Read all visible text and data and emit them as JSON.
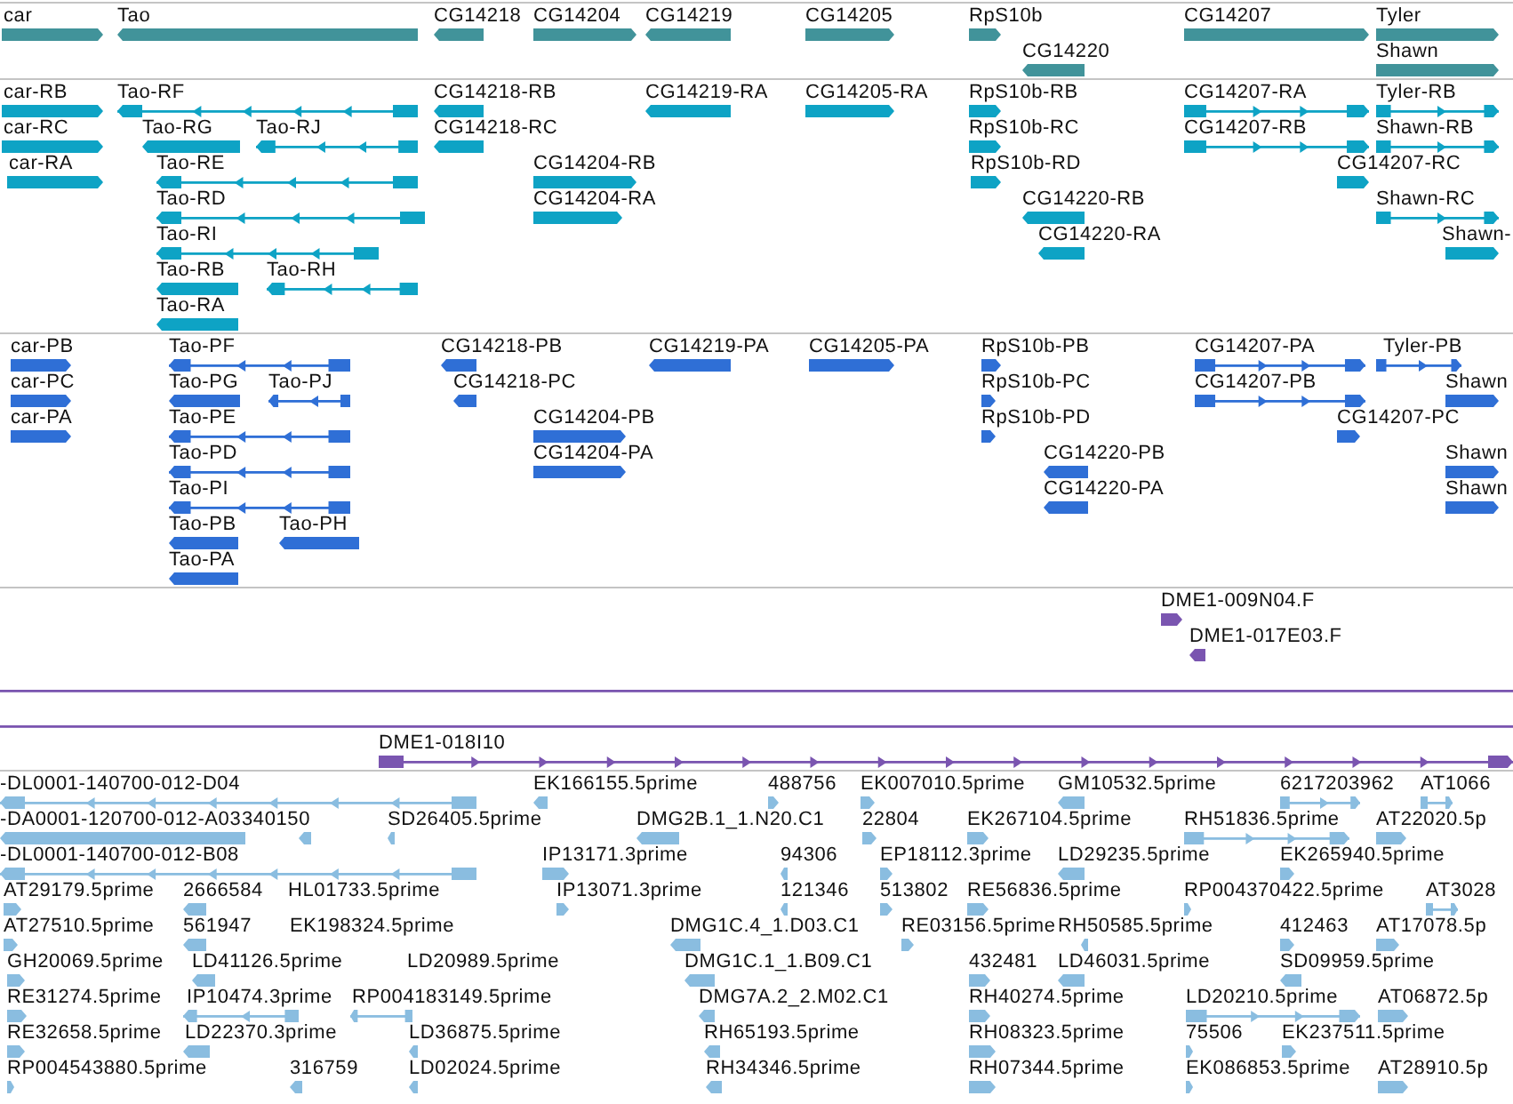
{
  "tracks": [
    {
      "color": "#41939a",
      "lanes": [
        {
          "features": [
            {
              "label": "car",
              "reverse": false,
              "kind": "block"
            },
            {
              "label": "Tao",
              "reverse": true,
              "kind": "block"
            },
            {
              "label": "CG14218",
              "reverse": true,
              "kind": "block"
            },
            {
              "label": "CG14204",
              "reverse": false,
              "kind": "block"
            },
            {
              "label": "CG14219",
              "reverse": true,
              "kind": "block"
            },
            {
              "label": "CG14205",
              "reverse": false,
              "kind": "block"
            },
            {
              "label": "RpS10b",
              "reverse": false,
              "kind": "block"
            },
            {
              "label": "CG14207",
              "reverse": false,
              "kind": "block"
            },
            {
              "label": "Tyler",
              "reverse": false,
              "kind": "block"
            }
          ]
        },
        {
          "features": [
            {
              "label": "CG14220",
              "reverse": true,
              "kind": "block"
            },
            {
              "label": "Shawn",
              "reverse": false,
              "kind": "block"
            }
          ]
        }
      ]
    },
    {
      "color": "#0ea3c5",
      "lanes": [
        {
          "features": [
            {
              "label": "car-RB",
              "reverse": false,
              "kind": "block"
            },
            {
              "label": "Tao-RF",
              "reverse": true,
              "kind": "spliced"
            },
            {
              "label": "CG14218-RB",
              "reverse": true,
              "kind": "block"
            },
            {
              "label": "CG14219-RA",
              "reverse": true,
              "kind": "block"
            },
            {
              "label": "CG14205-RA",
              "reverse": false,
              "kind": "block"
            },
            {
              "label": "RpS10b-RB",
              "reverse": false,
              "kind": "block"
            },
            {
              "label": "CG14207-RA",
              "reverse": false,
              "kind": "spliced"
            },
            {
              "label": "Tyler-RB",
              "reverse": false,
              "kind": "spliced"
            }
          ]
        },
        {
          "features": [
            {
              "label": "car-RC",
              "reverse": false,
              "kind": "block"
            },
            {
              "label": "Tao-RG",
              "reverse": true,
              "kind": "block"
            },
            {
              "label": "Tao-RJ",
              "reverse": true,
              "kind": "spliced"
            },
            {
              "label": "CG14218-RC",
              "reverse": true,
              "kind": "block"
            },
            {
              "label": "RpS10b-RC",
              "reverse": false,
              "kind": "block"
            },
            {
              "label": "CG14207-RB",
              "reverse": false,
              "kind": "spliced"
            },
            {
              "label": "Shawn-RB",
              "reverse": false,
              "kind": "spliced"
            }
          ]
        },
        {
          "features": [
            {
              "label": "car-RA",
              "reverse": false,
              "kind": "block"
            },
            {
              "label": "Tao-RE",
              "reverse": true,
              "kind": "spliced"
            },
            {
              "label": "CG14204-RB",
              "reverse": false,
              "kind": "block"
            },
            {
              "label": "RpS10b-RD",
              "reverse": false,
              "kind": "block"
            },
            {
              "label": "CG14207-RC",
              "reverse": false,
              "kind": "block"
            }
          ]
        },
        {
          "features": [
            {
              "label": "Tao-RD",
              "reverse": true,
              "kind": "spliced"
            },
            {
              "label": "CG14204-RA",
              "reverse": false,
              "kind": "block"
            },
            {
              "label": "CG14220-RB",
              "reverse": true,
              "kind": "block"
            },
            {
              "label": "Shawn-RC",
              "reverse": false,
              "kind": "spliced"
            }
          ]
        },
        {
          "features": [
            {
              "label": "Tao-RI",
              "reverse": true,
              "kind": "spliced"
            },
            {
              "label": "CG14220-RA",
              "reverse": true,
              "kind": "block"
            },
            {
              "label": "Shawn-",
              "reverse": false,
              "kind": "block"
            }
          ]
        },
        {
          "features": [
            {
              "label": "Tao-RB",
              "reverse": true,
              "kind": "block"
            },
            {
              "label": "Tao-RH",
              "reverse": true,
              "kind": "spliced"
            }
          ]
        },
        {
          "features": [
            {
              "label": "Tao-RA",
              "reverse": true,
              "kind": "block"
            }
          ]
        }
      ]
    },
    {
      "color": "#2f6fd6",
      "lanes": [
        {
          "features": [
            {
              "label": "car-PB",
              "reverse": false,
              "kind": "block"
            },
            {
              "label": "Tao-PF",
              "reverse": true,
              "kind": "spliced"
            },
            {
              "label": "CG14218-PB",
              "reverse": true,
              "kind": "block"
            },
            {
              "label": "CG14219-PA",
              "reverse": true,
              "kind": "block"
            },
            {
              "label": "CG14205-PA",
              "reverse": false,
              "kind": "block"
            },
            {
              "label": "RpS10b-PB",
              "reverse": false,
              "kind": "block"
            },
            {
              "label": "CG14207-PA",
              "reverse": false,
              "kind": "spliced"
            },
            {
              "label": "Tyler-PB",
              "reverse": false,
              "kind": "spliced"
            }
          ]
        },
        {
          "features": [
            {
              "label": "car-PC",
              "reverse": false,
              "kind": "block"
            },
            {
              "label": "Tao-PG",
              "reverse": true,
              "kind": "block"
            },
            {
              "label": "Tao-PJ",
              "reverse": true,
              "kind": "spliced"
            },
            {
              "label": "CG14218-PC",
              "reverse": true,
              "kind": "block"
            },
            {
              "label": "RpS10b-PC",
              "reverse": false,
              "kind": "block"
            },
            {
              "label": "CG14207-PB",
              "reverse": false,
              "kind": "spliced"
            },
            {
              "label": "Shawn",
              "reverse": false,
              "kind": "block"
            }
          ]
        },
        {
          "features": [
            {
              "label": "car-PA",
              "reverse": false,
              "kind": "block"
            },
            {
              "label": "Tao-PE",
              "reverse": true,
              "kind": "spliced"
            },
            {
              "label": "CG14204-PB",
              "reverse": false,
              "kind": "block"
            },
            {
              "label": "RpS10b-PD",
              "reverse": false,
              "kind": "block"
            },
            {
              "label": "CG14207-PC",
              "reverse": false,
              "kind": "block"
            }
          ]
        },
        {
          "features": [
            {
              "label": "Tao-PD",
              "reverse": true,
              "kind": "spliced"
            },
            {
              "label": "CG14204-PA",
              "reverse": false,
              "kind": "block"
            },
            {
              "label": "CG14220-PB",
              "reverse": true,
              "kind": "block"
            },
            {
              "label": "Shawn",
              "reverse": false,
              "kind": "block"
            }
          ]
        },
        {
          "features": [
            {
              "label": "Tao-PI",
              "reverse": true,
              "kind": "spliced"
            },
            {
              "label": "CG14220-PA",
              "reverse": true,
              "kind": "block"
            },
            {
              "label": "Shawn",
              "reverse": false,
              "kind": "block"
            }
          ]
        },
        {
          "features": [
            {
              "label": "Tao-PB",
              "reverse": true,
              "kind": "block"
            },
            {
              "label": "Tao-PH",
              "reverse": true,
              "kind": "block"
            }
          ]
        },
        {
          "features": [
            {
              "label": "Tao-PA",
              "reverse": true,
              "kind": "block"
            }
          ]
        }
      ]
    },
    {
      "color": "#7a55b0",
      "lanes": [
        {
          "features": [
            {
              "label": "DME1-009N04.F",
              "reverse": false,
              "kind": "block"
            }
          ]
        },
        {
          "features": [
            {
              "label": "DME1-017E03.F",
              "reverse": true,
              "kind": "block"
            }
          ]
        },
        {
          "features": [
            {
              "kind": "line"
            }
          ]
        },
        {
          "features": [
            {
              "kind": "line"
            }
          ]
        },
        {
          "features": [
            {
              "label": "DME1-018I10",
              "reverse": false,
              "kind": "spliced"
            }
          ]
        }
      ]
    },
    {
      "color": "#8abde0",
      "lanes": [
        {
          "features": [
            {
              "label": "-DL0001-140700-012-D04",
              "reverse": true,
              "kind": "spliced"
            },
            {
              "label": "EK166155.5prime",
              "reverse": true,
              "kind": "block"
            },
            {
              "label": "488756",
              "reverse": false,
              "kind": "block"
            },
            {
              "label": "EK007010.5prime",
              "reverse": false,
              "kind": "block"
            },
            {
              "label": "GM10532.5prime",
              "reverse": true,
              "kind": "block"
            },
            {
              "label": "6217203962",
              "reverse": false,
              "kind": "spliced"
            },
            {
              "label": "AT1066",
              "reverse": false,
              "kind": "spliced"
            }
          ]
        },
        {
          "features": [
            {
              "label": "-DA0001-120700-012-A03",
              "reverse": true,
              "kind": "block"
            },
            {
              "label": "340150",
              "reverse": true,
              "kind": "block"
            },
            {
              "label": "SD26405.5prime",
              "reverse": true,
              "kind": "block"
            },
            {
              "label": "DMG2B.1_1.N20.C1",
              "reverse": true,
              "kind": "block"
            },
            {
              "label": "22804",
              "reverse": false,
              "kind": "block"
            },
            {
              "label": "EK267104.5prime",
              "reverse": false,
              "kind": "block"
            },
            {
              "label": "RH51836.5prime",
              "reverse": false,
              "kind": "spliced"
            },
            {
              "label": "AT22020.5p",
              "reverse": false,
              "kind": "block"
            }
          ]
        },
        {
          "features": [
            {
              "label": "-DL0001-140700-012-B08",
              "reverse": true,
              "kind": "spliced"
            },
            {
              "label": "IP13171.3prime",
              "reverse": false,
              "kind": "block"
            },
            {
              "label": "94306",
              "reverse": true,
              "kind": "block"
            },
            {
              "label": "EP18112.3prime",
              "reverse": false,
              "kind": "block"
            },
            {
              "label": "LD29235.5prime",
              "reverse": true,
              "kind": "block"
            },
            {
              "label": "EK265940.5prime",
              "reverse": false,
              "kind": "block"
            }
          ]
        },
        {
          "features": [
            {
              "label": "AT29179.5prime",
              "reverse": false,
              "kind": "block"
            },
            {
              "label": "2666584",
              "reverse": true,
              "kind": "block"
            },
            {
              "label": "HL01733.5prime",
              "kind": "label"
            },
            {
              "label": "IP13071.3prime",
              "reverse": false,
              "kind": "block"
            },
            {
              "label": "121346",
              "reverse": true,
              "kind": "block"
            },
            {
              "label": "513802",
              "reverse": false,
              "kind": "block"
            },
            {
              "label": "RE56836.5prime",
              "reverse": false,
              "kind": "block"
            },
            {
              "label": "RP004370422.5prime",
              "reverse": false,
              "kind": "block"
            },
            {
              "label": "AT3028",
              "reverse": false,
              "kind": "spliced"
            }
          ]
        },
        {
          "features": [
            {
              "label": "AT27510.5prime",
              "reverse": false,
              "kind": "block"
            },
            {
              "label": "561947",
              "reverse": true,
              "kind": "block"
            },
            {
              "label": "EK198324.5prime",
              "kind": "label"
            },
            {
              "label": "DMG1C.4_1.D03.C1",
              "reverse": true,
              "kind": "block"
            },
            {
              "label": "RE03156.5prime",
              "reverse": false,
              "kind": "block"
            },
            {
              "label": "RH50585.5prime",
              "reverse": true,
              "kind": "block"
            },
            {
              "label": "412463",
              "reverse": false,
              "kind": "block"
            },
            {
              "label": "AT17078.5p",
              "reverse": false,
              "kind": "block"
            }
          ]
        },
        {
          "features": [
            {
              "label": "GH20069.5prime",
              "reverse": false,
              "kind": "block"
            },
            {
              "label": "LD41126.5prime",
              "reverse": true,
              "kind": "block"
            },
            {
              "label": "LD20989.5prime",
              "kind": "label"
            },
            {
              "label": "DMG1C.1_1.B09.C1",
              "reverse": true,
              "kind": "block"
            },
            {
              "label": "432481",
              "reverse": false,
              "kind": "block"
            },
            {
              "label": "LD46031.5prime",
              "reverse": true,
              "kind": "block"
            },
            {
              "label": "SD09959.5prime",
              "reverse": true,
              "kind": "block"
            }
          ]
        },
        {
          "features": [
            {
              "label": "RE31274.5prime",
              "reverse": false,
              "kind": "block"
            },
            {
              "label": "IP10474.3prime",
              "reverse": true,
              "kind": "spliced"
            },
            {
              "label": "RP004183149.5prime",
              "reverse": true,
              "kind": "spliced"
            },
            {
              "label": "DMG7A.2_2.M02.C1",
              "reverse": true,
              "kind": "block"
            },
            {
              "label": "RH40274.5prime",
              "reverse": false,
              "kind": "block"
            },
            {
              "label": "LD20210.5prime",
              "reverse": false,
              "kind": "spliced"
            },
            {
              "label": "AT06872.5p",
              "reverse": false,
              "kind": "block"
            }
          ]
        },
        {
          "features": [
            {
              "label": "RE32658.5prime",
              "reverse": false,
              "kind": "block"
            },
            {
              "label": "LD22370.3prime",
              "reverse": true,
              "kind": "block"
            },
            {
              "label": "LD36875.5prime",
              "reverse": true,
              "kind": "block"
            },
            {
              "label": "RH65193.5prime",
              "reverse": true,
              "kind": "block"
            },
            {
              "label": "RH08323.5prime",
              "reverse": false,
              "kind": "block"
            },
            {
              "label": "75506",
              "reverse": false,
              "kind": "block"
            },
            {
              "label": "EK237511.5prime",
              "reverse": false,
              "kind": "block"
            }
          ]
        },
        {
          "features": [
            {
              "label": "RP004543880.5prime",
              "reverse": false,
              "kind": "block"
            },
            {
              "label": "316759",
              "reverse": true,
              "kind": "block"
            },
            {
              "label": "LD02024.5prime",
              "reverse": true,
              "kind": "block"
            },
            {
              "label": "RH34346.5prime",
              "reverse": true,
              "kind": "block"
            },
            {
              "label": "RH07344.5prime",
              "reverse": false,
              "kind": "block"
            },
            {
              "label": "EK086853.5prime",
              "reverse": false,
              "kind": "block"
            },
            {
              "label": "AT28910.5p",
              "reverse": false,
              "kind": "block"
            }
          ]
        }
      ]
    }
  ]
}
